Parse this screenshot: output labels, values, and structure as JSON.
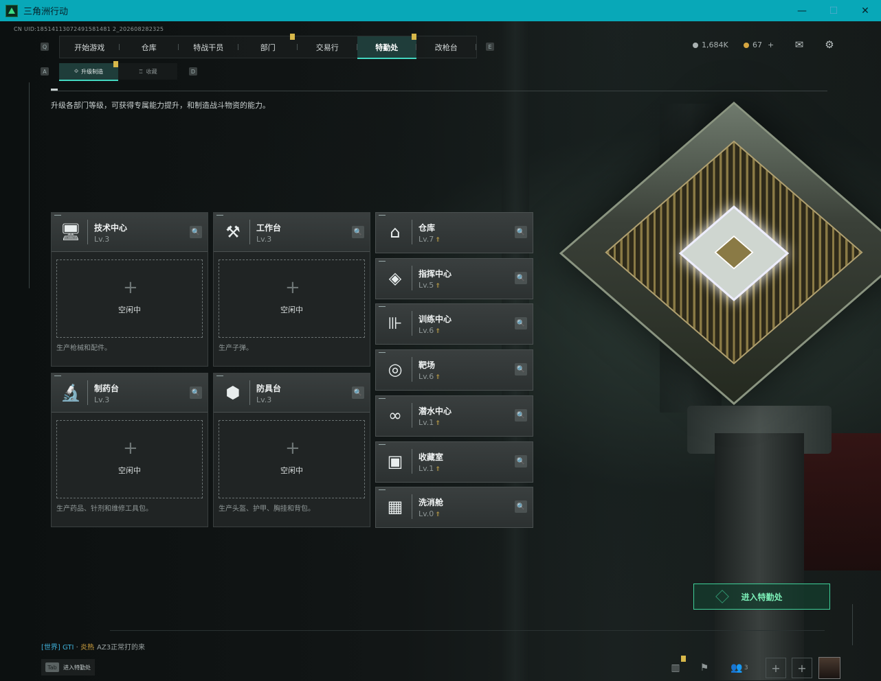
{
  "window": {
    "title": "三角洲行动",
    "minimize": "—",
    "maximize": "☐",
    "close": "✕"
  },
  "uid": "CN UID:18514113072491581481 2_202608282325",
  "nav": {
    "left_key": "Q",
    "right_key": "E",
    "tabs": [
      {
        "label": "开始游戏"
      },
      {
        "label": "仓库"
      },
      {
        "label": "特战干员"
      },
      {
        "label": "部门"
      },
      {
        "label": "交易行"
      },
      {
        "label": "特勤处"
      },
      {
        "label": "改枪台"
      }
    ],
    "active_tab": "特勤处"
  },
  "currency": {
    "silver": "1,684K",
    "gold": "67",
    "add": "+"
  },
  "subtabs": {
    "left_key": "A",
    "right_key": "D",
    "items": [
      {
        "label": "升级制造"
      },
      {
        "label": "收藏"
      }
    ]
  },
  "description": "升级各部门等级，可获得专属能力提升，和制造战斗物资的能力。",
  "production_cards": [
    {
      "name": "技术中心",
      "level": "Lv.3",
      "slot_status": "空闲中",
      "note": "生产枪械和配件。",
      "icon": "computer-icon"
    },
    {
      "name": "工作台",
      "level": "Lv.3",
      "slot_status": "空闲中",
      "note": "生产子弹。",
      "icon": "tools-icon"
    },
    {
      "name": "制药台",
      "level": "Lv.3",
      "slot_status": "空闲中",
      "note": "生产药品、针剂和维修工具包。",
      "icon": "microscope-icon"
    },
    {
      "name": "防具台",
      "level": "Lv.3",
      "slot_status": "空闲中",
      "note": "生产头盔、护甲、胸挂和背包。",
      "icon": "boxes-icon"
    }
  ],
  "facility_cards": [
    {
      "name": "仓库",
      "level": "Lv.7",
      "icon": "warehouse-icon"
    },
    {
      "name": "指挥中心",
      "level": "Lv.5",
      "icon": "command-icon"
    },
    {
      "name": "训练中心",
      "level": "Lv.6",
      "icon": "dumbbell-icon"
    },
    {
      "name": "靶场",
      "level": "Lv.6",
      "icon": "target-icon"
    },
    {
      "name": "潜水中心",
      "level": "Lv.1",
      "icon": "goggles-icon"
    },
    {
      "name": "收藏室",
      "level": "Lv.1",
      "icon": "display-case-icon"
    },
    {
      "name": "洗消舱",
      "level": "Lv.0",
      "icon": "decon-icon"
    }
  ],
  "enter_button": "进入特勤处",
  "chat": {
    "channel": "[世界]",
    "user": "GTI",
    "sep": " · ",
    "tag": "炎热",
    "message": "AZ3正常打的来"
  },
  "tab_hint": {
    "key": "Tab",
    "label": "进入特勤处"
  },
  "dock": {
    "friends_count": "3"
  },
  "colors": {
    "accent": "#43d7c0",
    "titlebar": "#08a8b8",
    "enter": "#3fd19a",
    "badge": "#d8b84a"
  }
}
